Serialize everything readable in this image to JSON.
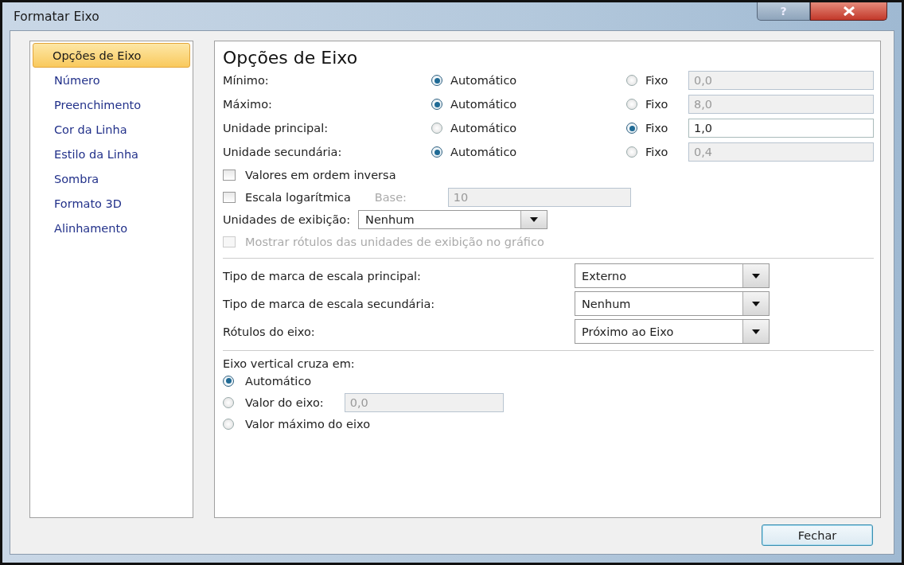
{
  "window": {
    "title": "Formatar Eixo",
    "help_button": "?"
  },
  "sidebar": {
    "items": [
      {
        "label": "Opções de Eixo",
        "selected": true
      },
      {
        "label": "Número",
        "selected": false
      },
      {
        "label": "Preenchimento",
        "selected": false
      },
      {
        "label": "Cor da Linha",
        "selected": false
      },
      {
        "label": "Estilo da Linha",
        "selected": false
      },
      {
        "label": "Sombra",
        "selected": false
      },
      {
        "label": "Formato 3D",
        "selected": false
      },
      {
        "label": "Alinhamento",
        "selected": false
      }
    ]
  },
  "panel": {
    "title": "Opções de Eixo",
    "axis_bounds": [
      {
        "label": "Mínimo:",
        "options": [
          {
            "label": "Automático",
            "selected": true
          },
          {
            "label": "Fixo",
            "selected": false
          }
        ],
        "value": "0,0",
        "disabled": true
      },
      {
        "label": "Máximo:",
        "options": [
          {
            "label": "Automático",
            "selected": true
          },
          {
            "label": "Fixo",
            "selected": false
          }
        ],
        "value": "8,0",
        "disabled": true
      },
      {
        "label": "Unidade principal:",
        "options": [
          {
            "label": "Automático",
            "selected": false
          },
          {
            "label": "Fixo",
            "selected": true
          }
        ],
        "value": "1,0",
        "disabled": false
      },
      {
        "label": "Unidade secundária:",
        "options": [
          {
            "label": "Automático",
            "selected": true
          },
          {
            "label": "Fixo",
            "selected": false
          }
        ],
        "value": "0,4",
        "disabled": true
      }
    ],
    "checks": [
      {
        "label": "Valores em ordem inversa",
        "checked": false,
        "disabled": false
      },
      {
        "label": "Escala logarítmica",
        "checked": false,
        "disabled": false,
        "base_label": "Base:",
        "base_value": "10",
        "base_disabled": true
      }
    ],
    "display_units": {
      "label": "Unidades de exibição:",
      "value": "Nenhum"
    },
    "show_units_label": {
      "label": "Mostrar rótulos das unidades de exibição no gráfico",
      "checked": false,
      "disabled": true
    },
    "dropdowns": [
      {
        "label": "Tipo de marca de escala principal:",
        "value": "Externo"
      },
      {
        "label": "Tipo de marca de escala secundária:",
        "value": "Nenhum"
      },
      {
        "label": "Rótulos do eixo:",
        "value": "Próximo ao Eixo"
      }
    ],
    "crosses": {
      "label": "Eixo vertical cruza em:",
      "options": [
        {
          "label": "Automático",
          "selected": true
        },
        {
          "label": "Valor do eixo:",
          "selected": false,
          "value": "0,0",
          "disabled": true
        },
        {
          "label": "Valor máximo do eixo",
          "selected": false
        }
      ]
    }
  },
  "buttons": [
    {
      "label": "Fechar"
    }
  ]
}
